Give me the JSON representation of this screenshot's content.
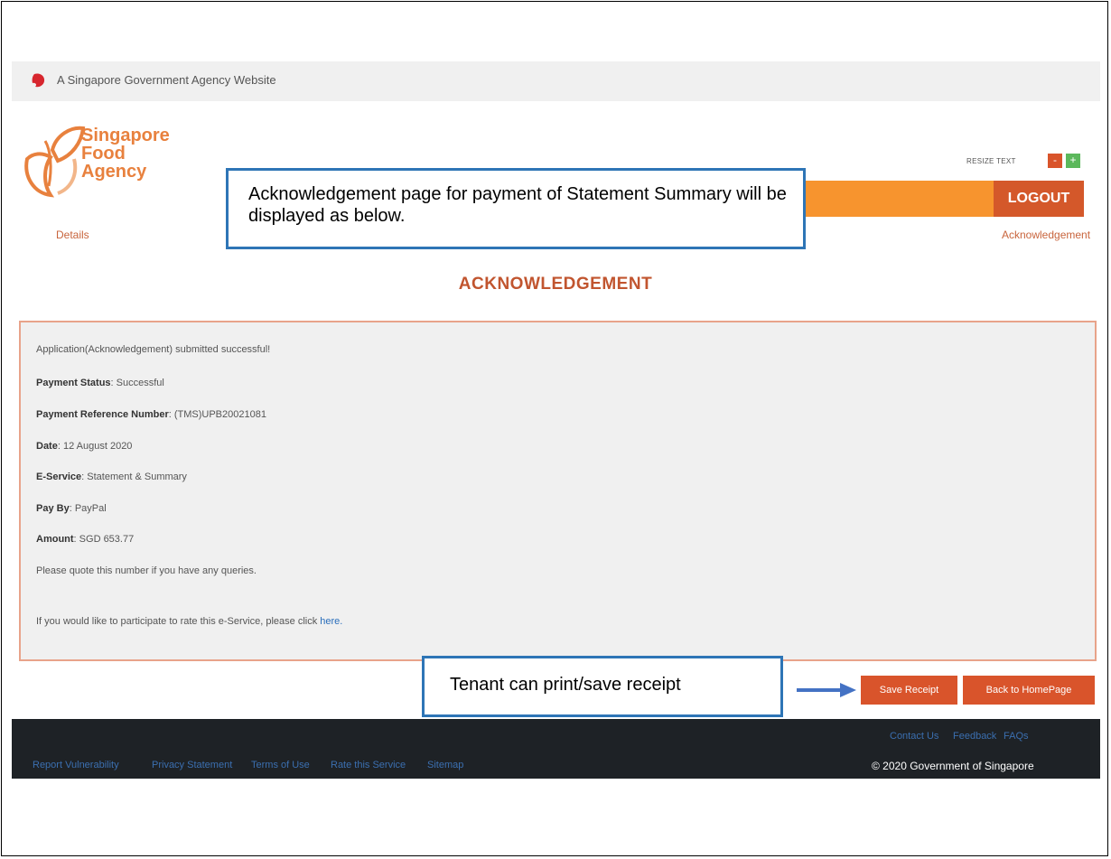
{
  "gov_banner": {
    "text": "A Singapore Government Agency Website"
  },
  "logo": {
    "line1": "Singapore",
    "line2": "Food",
    "line3": "Agency"
  },
  "header": {
    "resize_text": "RESIZE TEXT",
    "resize_minus": "-",
    "resize_plus": "+",
    "logout": "LOGOUT"
  },
  "breadcrumb": {
    "left": "Details",
    "right": "Acknowledgement"
  },
  "callouts": {
    "top": "Acknowledgement page for payment of Statement Summary will be displayed as below.",
    "bottom": "Tenant can print/save receipt"
  },
  "page_title": "ACKNOWLEDGEMENT",
  "ack": {
    "submitted": "Application(Acknowledgement) submitted successful!",
    "payment_status_label": "Payment Status",
    "payment_status": "Successful",
    "ref_label": "Payment Reference Number",
    "ref": "(TMS)UPB20021081",
    "date_label": "Date",
    "date": "12 August 2020",
    "eservice_label": "E-Service",
    "eservice": "Statement & Summary",
    "payby_label": "Pay By",
    "payby": "PayPal",
    "amount_label": "Amount",
    "amount": "SGD 653.77",
    "quote": "Please quote this number if you have any queries.",
    "rate_text": "If you would like to participate to rate this e-Service, please click",
    "rate_link": "here."
  },
  "buttons": {
    "save": "Save Receipt",
    "home": "Back to HomePage"
  },
  "footer": {
    "contact": "Contact Us",
    "feedback": "Feedback",
    "faqs": "FAQs",
    "report": "Report Vulnerability",
    "privacy": "Privacy Statement",
    "terms": "Terms of Use",
    "rate": "Rate this Service",
    "sitemap": "Sitemap",
    "copyright": "© 2020 Government of Singapore"
  },
  "colors": {
    "accent": "#d9542b",
    "orange_bar": "#f7942e",
    "callout_border": "#2e75b6",
    "footer_bg": "#1e2226"
  }
}
